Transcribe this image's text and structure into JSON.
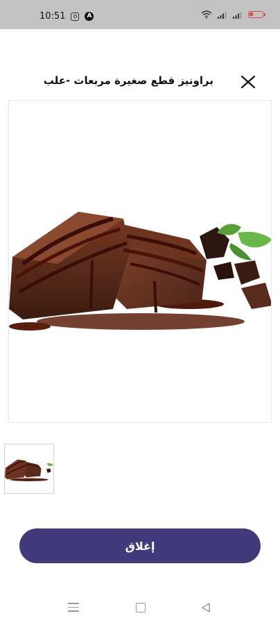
{
  "status_bar": {
    "time": "10:51",
    "icons": [
      "instagram-icon",
      "a-badge-icon",
      "wifi-icon",
      "signal-icon",
      "signal-icon",
      "battery-icon"
    ],
    "battery_level": 0.25,
    "battery_color": "#d84a4a"
  },
  "header": {
    "title": "براونيز قطع صغيرة مربعات -علب",
    "close_icon": "close-icon"
  },
  "gallery": {
    "main_image": "brownie-product-image",
    "thumbnails": [
      "brownie-thumbnail"
    ]
  },
  "actions": {
    "close_label": "إغلاق",
    "button_color": "#403a7a"
  },
  "nav_bar": {
    "icons": [
      "menu-icon",
      "home-icon",
      "back-icon"
    ]
  }
}
